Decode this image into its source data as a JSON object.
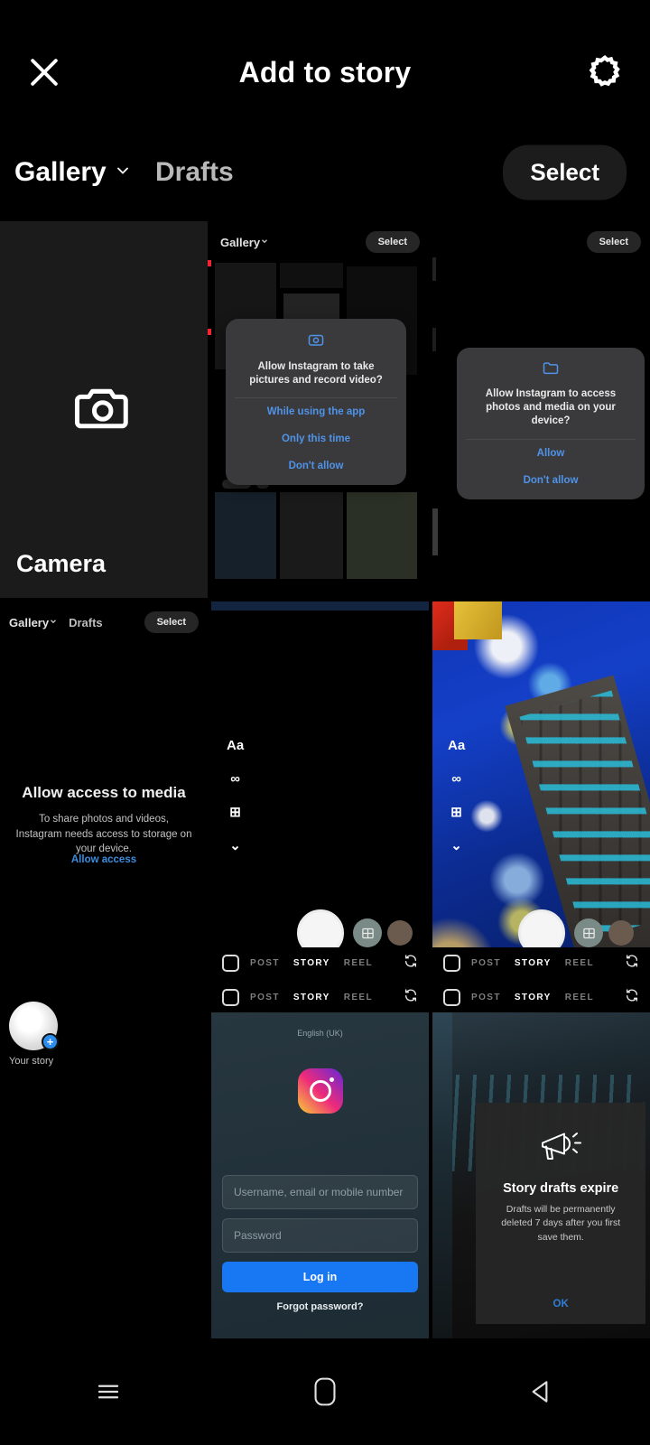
{
  "appbar": {
    "close_icon": "close-icon",
    "title": "Add to story",
    "settings_icon": "gear-icon"
  },
  "subbar": {
    "gallery_label": "Gallery",
    "gallery_chevron_icon": "chevron-down-icon",
    "drafts_label": "Drafts",
    "select_label": "Select",
    "highlight_color": "#f42433"
  },
  "grid": {
    "camera_tile": {
      "icon": "camera-icon",
      "label": "Camera"
    },
    "thumb_camera_permission": {
      "header_gallery": "Gallery",
      "header_select": "Select",
      "dialog": {
        "icon": "camera-permission-icon",
        "question": "Allow Instagram to take pictures and record video?",
        "options": [
          "While using the app",
          "Only this time",
          "Don't allow"
        ]
      }
    },
    "thumb_storage_permission": {
      "header_select": "Select",
      "dialog": {
        "icon": "folder-icon",
        "question": "Allow Instagram to access photos and media on your device?",
        "options": [
          "Allow",
          "Don't allow"
        ]
      }
    },
    "thumb_allow_media": {
      "header_gallery": "Gallery",
      "header_drafts": "Drafts",
      "header_select": "Select",
      "title": "Allow access to media",
      "subtitle": "To share photos and videos, Instagram needs access to storage on your device.",
      "link": "Allow access"
    },
    "thumb_camera_dark": {
      "tools": [
        "Aa",
        "∞",
        "⊞",
        "⌄"
      ],
      "mode_bar": {
        "modes": [
          "POST",
          "STORY",
          "REEL"
        ],
        "active": "STORY"
      }
    },
    "thumb_camera_photo": {
      "tools": [
        "Aa",
        "∞",
        "⊞",
        "⌄"
      ],
      "mode_bar": {
        "modes": [
          "POST",
          "STORY",
          "REEL"
        ],
        "active": "STORY"
      }
    },
    "thumb_your_story": {
      "avatar_label": "Your story",
      "add_badge": "+"
    },
    "thumb_login": {
      "language": "English (UK)",
      "logo": "instagram-logo",
      "username_placeholder": "Username, email or mobile number",
      "password_placeholder": "Password",
      "login_button": "Log in",
      "forgot_link": "Forgot password?",
      "mode_bar": {
        "modes": [
          "POST",
          "STORY",
          "REEL"
        ],
        "active": "STORY"
      }
    },
    "thumb_drafts_expire": {
      "icon": "megaphone-icon",
      "title": "Story drafts expire",
      "body": "Drafts will be permanently deleted 7 days after you first save them.",
      "ok": "OK",
      "mode_bar": {
        "modes": [
          "POST",
          "STORY",
          "REEL"
        ],
        "active": "STORY"
      }
    }
  },
  "navbar": {
    "recents_icon": "menu-icon",
    "home_icon": "home-icon",
    "back_icon": "back-icon"
  }
}
